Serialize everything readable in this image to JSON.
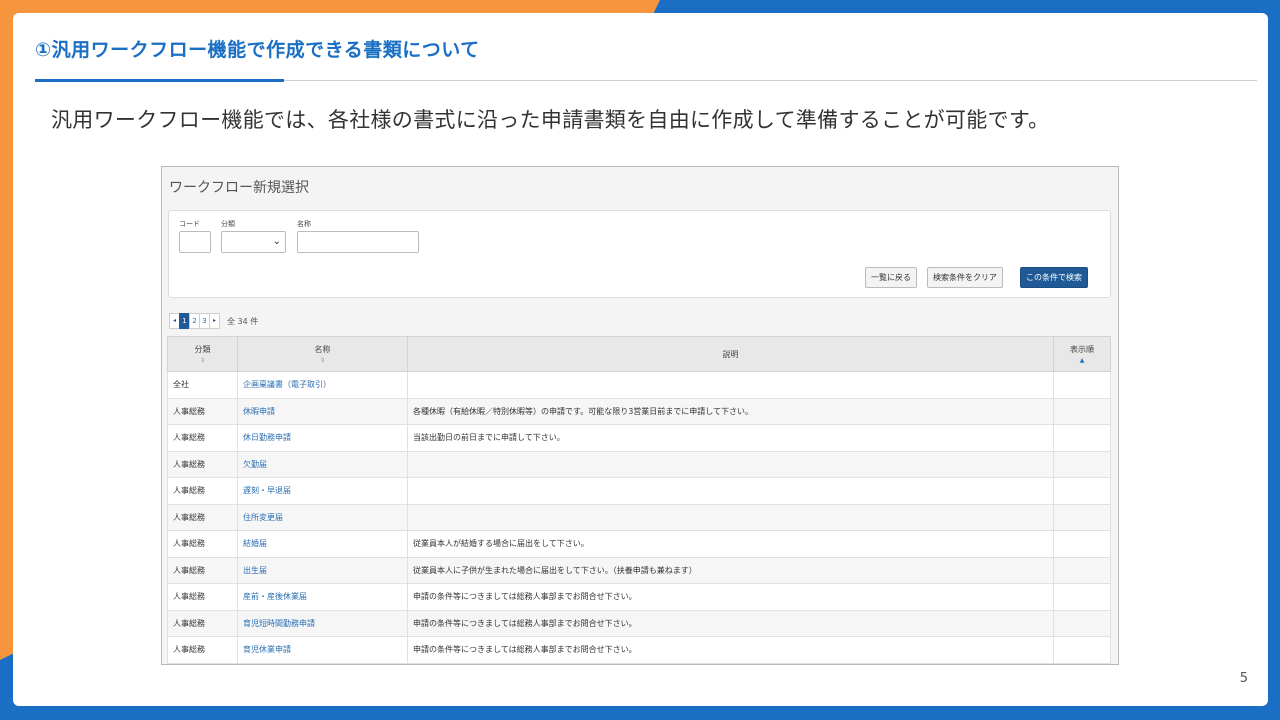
{
  "slide": {
    "title": "①汎用ワークフロー機能で作成できる書類について",
    "intro": "汎用ワークフロー機能では、各社様の書式に沿った申請書類を自由に作成して準備することが可能です。",
    "page_number": "5"
  },
  "screenshot": {
    "title": "ワークフロー新規選択",
    "filters": {
      "code_label": "コード",
      "bunrui_label": "分類",
      "name_label": "名称",
      "code_value": "",
      "bunrui_value": "",
      "name_value": ""
    },
    "buttons": {
      "back": "一覧に戻る",
      "clear": "検索条件をクリア",
      "search": "この条件で検索"
    },
    "pagination": {
      "prev": "◂",
      "pages": [
        "1",
        "2",
        "3"
      ],
      "next": "▸",
      "total": "全 34 件"
    },
    "table": {
      "headers": [
        "分類",
        "名称",
        "説明",
        "表示順"
      ],
      "rows": [
        {
          "category": "全社",
          "name": "企画稟議書（電子取引）",
          "desc": ""
        },
        {
          "category": "人事総務",
          "name": "休暇申請",
          "desc": "各種休暇（有給休暇／特別休暇等）の申請です。可能な限り3営業日前までに申請して下さい。"
        },
        {
          "category": "人事総務",
          "name": "休日勤務申請",
          "desc": "当該出勤日の前日までに申請して下さい。"
        },
        {
          "category": "人事総務",
          "name": "欠勤届",
          "desc": ""
        },
        {
          "category": "人事総務",
          "name": "遅刻・早退届",
          "desc": ""
        },
        {
          "category": "人事総務",
          "name": "住所変更届",
          "desc": ""
        },
        {
          "category": "人事総務",
          "name": "結婚届",
          "desc": "従業員本人が結婚する場合に届出をして下さい。"
        },
        {
          "category": "人事総務",
          "name": "出生届",
          "desc": "従業員本人に子供が生まれた場合に届出をして下さい。（扶養申請も兼ねます）"
        },
        {
          "category": "人事総務",
          "name": "産前・産後休業届",
          "desc": "申請の条件等につきましては総務人事部までお問合せ下さい。"
        },
        {
          "category": "人事総務",
          "name": "育児短時間勤務申請",
          "desc": "申請の条件等につきましては総務人事部までお問合せ下さい。"
        },
        {
          "category": "人事総務",
          "name": "育児休業申請",
          "desc": "申請の条件等につきましては総務人事部までお問合せ下さい。"
        }
      ]
    }
  }
}
